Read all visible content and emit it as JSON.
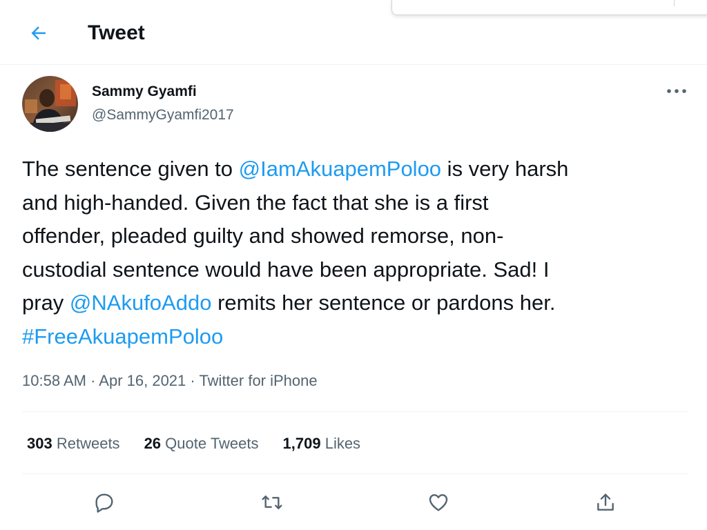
{
  "header": {
    "title": "Tweet"
  },
  "author": {
    "name": "Sammy Gyamfi",
    "handle": "@SammyGyamfi2017"
  },
  "tweet": {
    "line1_a": "The sentence given to ",
    "mention1": "@IamAkuapemPoloo",
    "line1_b": " is very harsh",
    "line2": "and high-handed. Given the fact that she is a first",
    "line3": "offender, pleaded guilty and showed remorse, non-",
    "line4": "custodial sentence would have been appropriate. Sad! I",
    "line5_a": "pray ",
    "mention2": "@NAkufoAddo",
    "line5_b": " remits her sentence or pardons her.",
    "hashtag": "#FreeAkuapemPoloo"
  },
  "meta": {
    "time": "10:58 AM",
    "sep1": " · ",
    "date": "Apr 16, 2021",
    "sep2": " · ",
    "source": "Twitter for iPhone"
  },
  "stats": {
    "retweets_count": "303",
    "retweets_label": "Retweets",
    "quotes_count": "26",
    "quotes_label": "Quote Tweets",
    "likes_count": "1,709",
    "likes_label": "Likes"
  },
  "icons": {
    "back": "arrow-left-icon",
    "more": "more-horizontal-icon",
    "reply": "reply-icon",
    "retweet": "retweet-icon",
    "like": "heart-icon",
    "share": "share-icon"
  },
  "colors": {
    "accent": "#1d9bf0",
    "text": "#0f1419",
    "secondary": "#536471",
    "divider": "#eff3f4"
  }
}
